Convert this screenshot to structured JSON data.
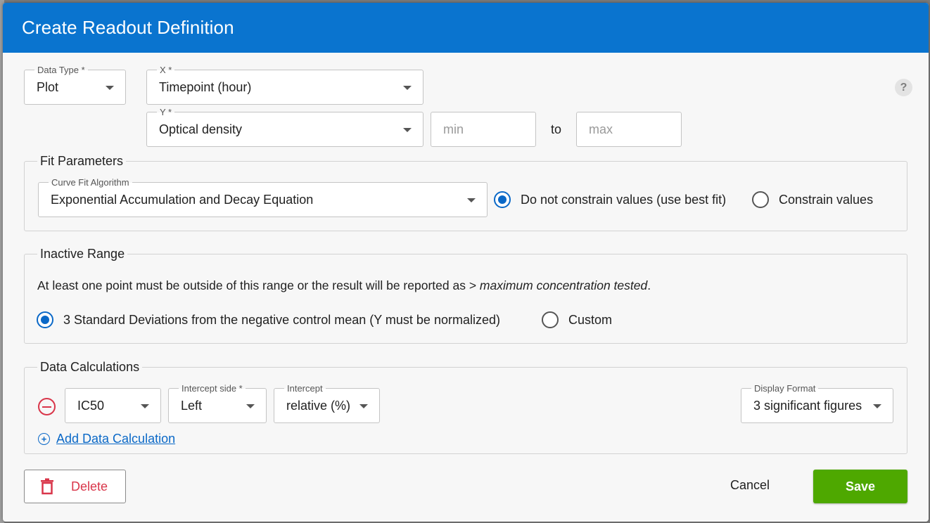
{
  "dialog": {
    "title": "Create Readout Definition"
  },
  "top_fields": {
    "data_type": {
      "label": "Data Type *",
      "value": "Plot"
    },
    "x": {
      "label": "X *",
      "value": "Timepoint (hour)"
    },
    "y": {
      "label": "Y *",
      "value": "Optical density"
    },
    "min": {
      "placeholder": "min"
    },
    "to_label": "to",
    "max": {
      "placeholder": "max"
    },
    "help_icon": "?"
  },
  "fit_parameters": {
    "legend": "Fit Parameters",
    "algorithm": {
      "label": "Curve Fit Algorithm",
      "value": "Exponential Accumulation and Decay Equation"
    },
    "options": [
      {
        "label": "Do not constrain values (use best fit)",
        "checked": true
      },
      {
        "label": "Constrain values",
        "checked": false
      }
    ]
  },
  "inactive_range": {
    "legend": "Inactive Range",
    "note_prefix": "At least one point must be outside of this range or the result will be reported as > ",
    "note_emphasis": "maximum concentration tested",
    "note_suffix": ".",
    "options": [
      {
        "label": "3 Standard Deviations from the negative control mean (Y must be normalized)",
        "checked": true
      },
      {
        "label": "Custom",
        "checked": false
      }
    ]
  },
  "data_calculations": {
    "legend": "Data Calculations",
    "calc": {
      "value": "IC50"
    },
    "intercept_side": {
      "label": "Intercept side *",
      "value": "Left"
    },
    "intercept": {
      "label": "Intercept",
      "value": "relative (%)"
    },
    "display_format": {
      "label": "Display Format",
      "value": "3 significant figures"
    },
    "add_label": "Add Data Calculation"
  },
  "footer": {
    "delete_label": "Delete",
    "cancel_label": "Cancel",
    "save_label": "Save"
  },
  "colors": {
    "header": "#0a74cf",
    "radio_checked": "#0a68c7",
    "delete": "#d9364a",
    "save": "#4ea800"
  }
}
